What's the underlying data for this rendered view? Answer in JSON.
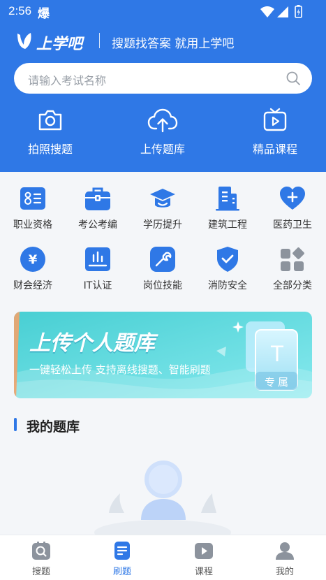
{
  "status_bar": {
    "time": "2:56",
    "notification": "爆"
  },
  "brand": {
    "name": "上学吧",
    "slogan": "搜题找答案 就用上学吧"
  },
  "search": {
    "placeholder": "请输入考试名称"
  },
  "quick_actions": [
    {
      "label": "拍照搜题",
      "icon": "camera-icon"
    },
    {
      "label": "上传题库",
      "icon": "cloud-upload-icon"
    },
    {
      "label": "精品课程",
      "icon": "tv-icon"
    }
  ],
  "categories": [
    {
      "label": "职业资格",
      "icon": "id-card-icon"
    },
    {
      "label": "考公考编",
      "icon": "briefcase-icon"
    },
    {
      "label": "学历提升",
      "icon": "graduation-cap-icon"
    },
    {
      "label": "建筑工程",
      "icon": "building-icon"
    },
    {
      "label": "医药卫生",
      "icon": "heart-plus-icon"
    },
    {
      "label": "财会经济",
      "icon": "yuan-icon"
    },
    {
      "label": "IT认证",
      "icon": "monitor-icon"
    },
    {
      "label": "岗位技能",
      "icon": "wrench-icon"
    },
    {
      "label": "消防安全",
      "icon": "shield-check-icon"
    },
    {
      "label": "全部分类",
      "icon": "grid-icon"
    }
  ],
  "banner": {
    "title": "上传个人题库",
    "subtitle": "一键轻松上传  支持离线搜题、智能刷题",
    "badge_letter": "T",
    "badge_label": "专属"
  },
  "my_bank": {
    "title": "我的题库"
  },
  "tab_bar": [
    {
      "label": "搜题",
      "icon": "search-tab-icon",
      "active": false
    },
    {
      "label": "刷题",
      "icon": "document-tab-icon",
      "active": true
    },
    {
      "label": "课程",
      "icon": "play-tab-icon",
      "active": false
    },
    {
      "label": "我的",
      "icon": "user-tab-icon",
      "active": false
    }
  ],
  "colors": {
    "primary": "#2f78e6",
    "banner_start": "#4fd3d6",
    "banner_end": "#7ae6ec",
    "background": "#f4f6f9"
  }
}
